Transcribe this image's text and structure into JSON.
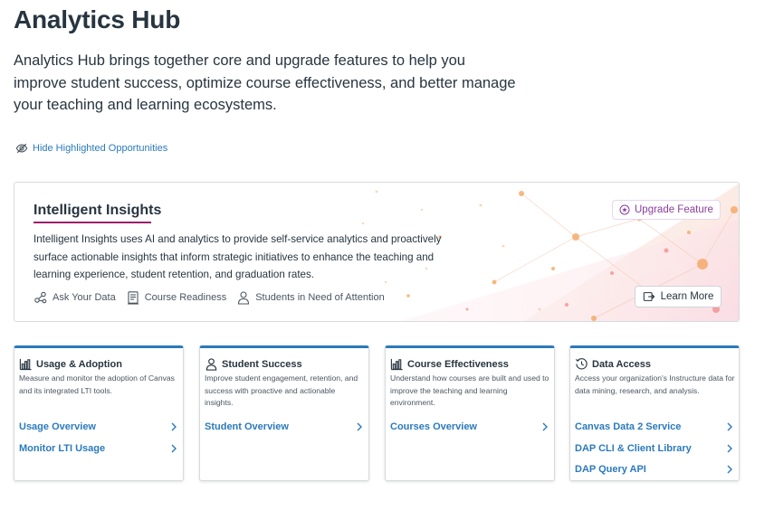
{
  "page": {
    "title": "Analytics Hub",
    "intro": "Analytics Hub brings together core and upgrade features to help you improve student success, optimize course effectiveness, and better manage your teaching and learning ecosystems."
  },
  "hide_link": {
    "label": "Hide Highlighted Opportunities",
    "icon": "eye-slash-icon"
  },
  "insights": {
    "title": "Intelligent Insights",
    "description": "Intelligent Insights uses AI and analytics to provide self-service analytics and proactively surface actionable insights that inform strategic initiatives to enhance the teaching and learning experience, student retention, and graduation rates.",
    "chips": [
      {
        "label": "Ask Your Data",
        "icon": "nodes-icon"
      },
      {
        "label": "Course Readiness",
        "icon": "document-icon"
      },
      {
        "label": "Students in Need of Attention",
        "icon": "person-search-icon"
      }
    ],
    "badge": "Upgrade Feature",
    "learn_more": "Learn More"
  },
  "cards": [
    {
      "title": "Usage & Adoption",
      "icon": "bar-chart-icon",
      "description": "Measure and monitor the adoption of Canvas and its integrated LTI tools.",
      "links": [
        "Usage Overview",
        "Monitor LTI Usage"
      ]
    },
    {
      "title": "Student Success",
      "icon": "person-icon",
      "description": "Improve student engagement, retention, and success with proactive and actionable insights.",
      "links": [
        "Student Overview"
      ]
    },
    {
      "title": "Course Effectiveness",
      "icon": "bar-chart-icon",
      "description": "Understand how courses are built and used to improve the teaching and learning environment.",
      "links": [
        "Courses Overview"
      ]
    },
    {
      "title": "Data Access",
      "icon": "refresh-clock-icon",
      "description": "Access your organization's Instructure data for data mining, research, and analysis.",
      "links": [
        "Canvas Data 2 Service",
        "DAP CLI & Client Library",
        "DAP Query API"
      ]
    }
  ],
  "colors": {
    "link": "#2b7abc",
    "text": "#273540",
    "accent": "#9e1e6b",
    "upgrade": "#8b3e9e"
  }
}
